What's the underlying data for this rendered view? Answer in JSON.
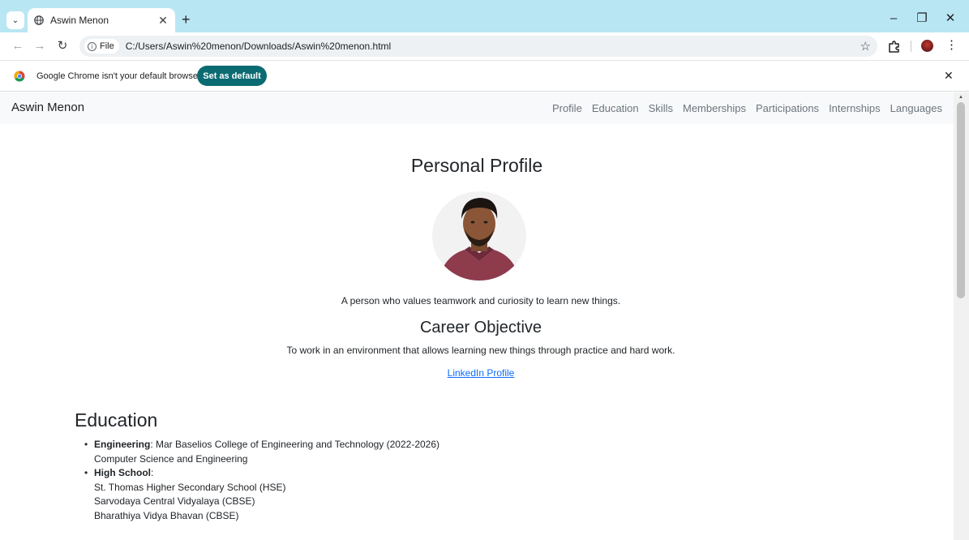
{
  "browser": {
    "tab_title": "Aswin Menon",
    "new_tab_symbol": "+",
    "url_chip": "File",
    "url": "C:/Users/Aswin%20menon/Downloads/Aswin%20menon.html",
    "window_controls": {
      "minimize": "–",
      "restore": "❐",
      "close": "✕"
    },
    "icons": [
      "chevron-down-icon",
      "globe-icon",
      "close-icon",
      "back-arrow-icon",
      "forward-arrow-icon",
      "reload-icon",
      "info-icon",
      "star-icon",
      "extensions-icon",
      "profile-avatar",
      "more-menu-icon",
      "chrome-logo-icon"
    ]
  },
  "infobar": {
    "message": "Google Chrome isn't your default browser",
    "button_label": "Set as default"
  },
  "site": {
    "brand": "Aswin Menon",
    "nav": [
      "Profile",
      "Education",
      "Skills",
      "Memberships",
      "Participations",
      "Internships",
      "Languages"
    ],
    "profile": {
      "heading": "Personal Profile",
      "tagline": "A person who values teamwork and curiosity to learn new things."
    },
    "career": {
      "heading": "Career Objective",
      "text": "To work in an environment that allows learning new things through practice and hard work.",
      "link_label": "LinkedIn Profile"
    },
    "education": {
      "heading": "Education",
      "items": [
        {
          "label": "Engineering",
          "line1": ": Mar Baselios College of Engineering and Technology (2022-2026)",
          "lines": [
            "Computer Science and Engineering"
          ]
        },
        {
          "label": "High School",
          "line1": ":",
          "lines": [
            "St. Thomas Higher Secondary School (HSE)",
            "Sarvodaya Central Vidyalaya (CBSE)",
            "Bharathiya Vidya Bhavan (CBSE)"
          ]
        }
      ]
    }
  },
  "colors": {
    "tabstrip": "#b9e6f3",
    "default_button": "#0b6b73",
    "link": "#0d6efd",
    "navbar_bg": "#f8f9fa",
    "nav_link": "#6c757d"
  }
}
